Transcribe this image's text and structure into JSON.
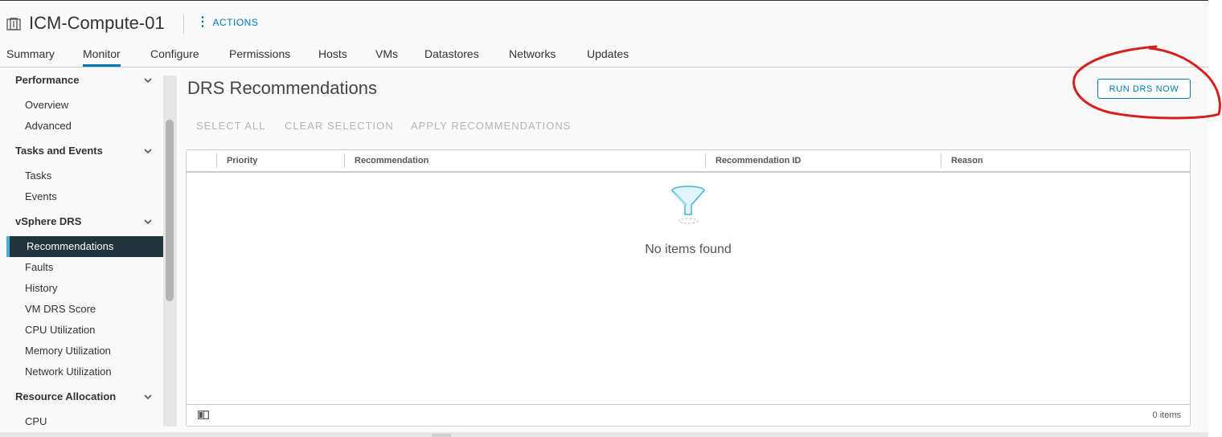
{
  "header": {
    "object_icon": "cluster-icon",
    "title": "ICM-Compute-01",
    "actions_label": "ACTIONS"
  },
  "tabs": [
    {
      "label": "Summary",
      "active": false
    },
    {
      "label": "Monitor",
      "active": true
    },
    {
      "label": "Configure",
      "active": false
    },
    {
      "label": "Permissions",
      "active": false
    },
    {
      "label": "Hosts",
      "active": false
    },
    {
      "label": "VMs",
      "active": false
    },
    {
      "label": "Datastores",
      "active": false
    },
    {
      "label": "Networks",
      "active": false
    },
    {
      "label": "Updates",
      "active": false
    }
  ],
  "sidebar": {
    "sections": [
      {
        "label": "Performance",
        "items": [
          "Overview",
          "Advanced"
        ]
      },
      {
        "label": "Tasks and Events",
        "items": [
          "Tasks",
          "Events"
        ]
      },
      {
        "label": "vSphere DRS",
        "items": [
          "Recommendations",
          "Faults",
          "History",
          "VM DRS Score",
          "CPU Utilization",
          "Memory Utilization",
          "Network Utilization"
        ]
      },
      {
        "label": "Resource Allocation",
        "items": [
          "CPU"
        ]
      }
    ],
    "selected_item": "Recommendations"
  },
  "main": {
    "title": "DRS Recommendations",
    "run_button": "RUN DRS NOW",
    "actions": [
      "SELECT ALL",
      "CLEAR SELECTION",
      "APPLY RECOMMENDATIONS"
    ],
    "grid": {
      "columns": [
        "Priority",
        "Recommendation",
        "Recommendation ID",
        "Reason"
      ],
      "rows": [],
      "empty_icon": "filter-funnel-icon",
      "empty_message": "No items found",
      "footer_count": "0 items"
    }
  },
  "colors": {
    "accent": "#0079b8",
    "selected_bg": "#22343c",
    "annotation": "#d42020"
  }
}
